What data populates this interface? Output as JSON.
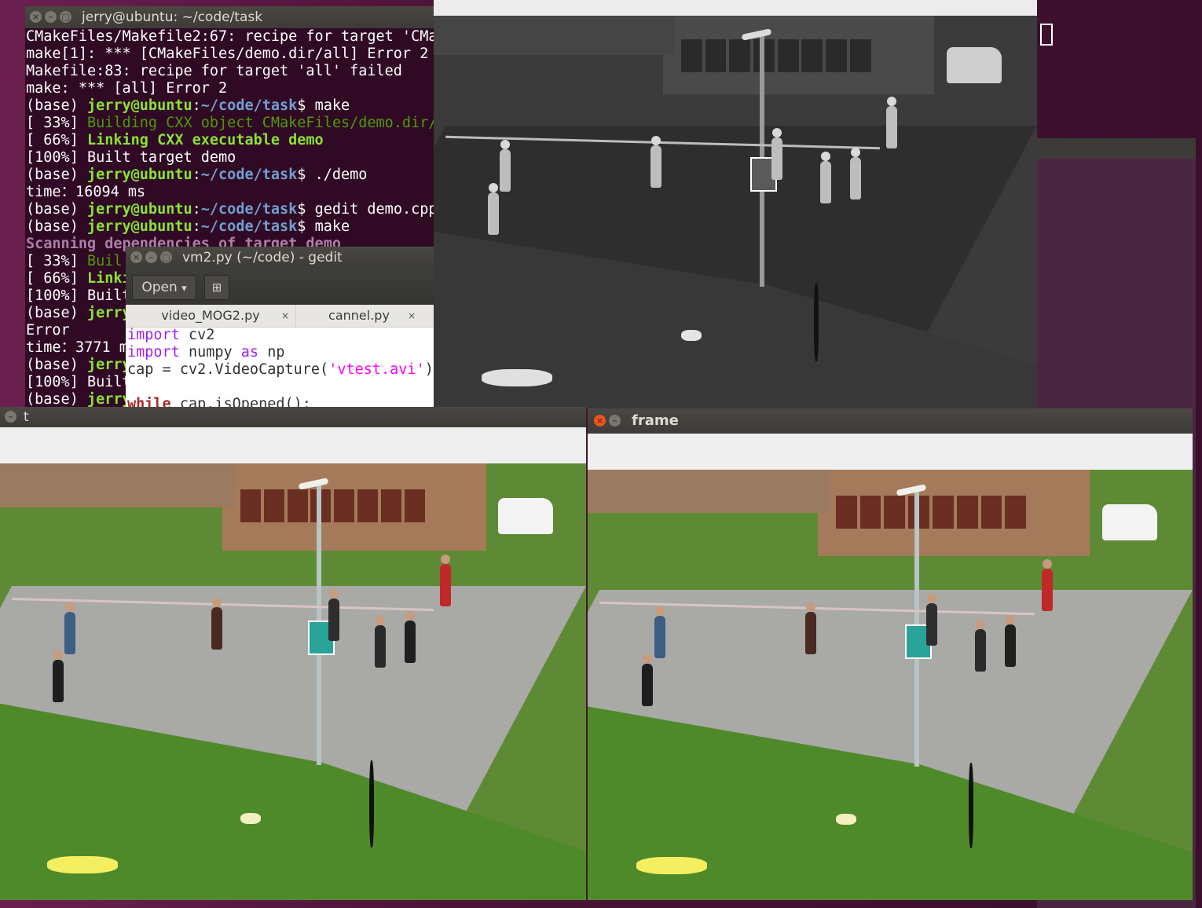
{
  "terminal": {
    "title": "jerry@ubuntu: ~/code/task",
    "lines": [
      [
        {
          "t": "CMakeFiles/Makefile2:67: recipe for target 'CMa",
          "c": ""
        }
      ],
      [
        {
          "t": "make[1]: *** [CMakeFiles/demo.dir/all] Error 2",
          "c": ""
        }
      ],
      [
        {
          "t": "Makefile:83: recipe for target 'all' failed",
          "c": ""
        }
      ],
      [
        {
          "t": "make: *** [all] Error 2",
          "c": ""
        }
      ],
      [
        {
          "t": "(base) ",
          "c": ""
        },
        {
          "t": "jerry@ubuntu",
          "c": "pgreen"
        },
        {
          "t": ":",
          "c": ""
        },
        {
          "t": "~/code/task",
          "c": "pblue"
        },
        {
          "t": "$ make",
          "c": ""
        }
      ],
      [
        {
          "t": "[ 33%] ",
          "c": ""
        },
        {
          "t": "Building CXX object CMakeFiles/demo.dir/",
          "c": "cgreen"
        }
      ],
      [
        {
          "t": "[ 66%] ",
          "c": ""
        },
        {
          "t": "Linking CXX executable demo",
          "c": "cgreenb"
        }
      ],
      [
        {
          "t": "[100%] Built target demo",
          "c": ""
        }
      ],
      [
        {
          "t": "(base) ",
          "c": ""
        },
        {
          "t": "jerry@ubuntu",
          "c": "pgreen"
        },
        {
          "t": ":",
          "c": ""
        },
        {
          "t": "~/code/task",
          "c": "pblue"
        },
        {
          "t": "$ ./demo",
          "c": ""
        }
      ],
      [
        {
          "t": "time：16094 ms",
          "c": ""
        }
      ],
      [
        {
          "t": "(base) ",
          "c": ""
        },
        {
          "t": "jerry@ubuntu",
          "c": "pgreen"
        },
        {
          "t": ":",
          "c": ""
        },
        {
          "t": "~/code/task",
          "c": "pblue"
        },
        {
          "t": "$ gedit demo.cpp",
          "c": ""
        }
      ],
      [
        {
          "t": "(base) ",
          "c": ""
        },
        {
          "t": "jerry@ubuntu",
          "c": "pgreen"
        },
        {
          "t": ":",
          "c": ""
        },
        {
          "t": "~/code/task",
          "c": "pblue"
        },
        {
          "t": "$ make",
          "c": ""
        }
      ],
      [
        {
          "t": "Scanning dependencies of target demo",
          "c": "cmag"
        }
      ],
      [
        {
          "t": "[ 33%] ",
          "c": ""
        },
        {
          "t": "Buil",
          "c": "cgreen"
        }
      ],
      [
        {
          "t": "[ 66%] ",
          "c": ""
        },
        {
          "t": "Linki",
          "c": "cgreenb"
        }
      ],
      [
        {
          "t": "[100%] Built",
          "c": ""
        }
      ],
      [
        {
          "t": "(base) ",
          "c": ""
        },
        {
          "t": "jerry",
          "c": "pgreen"
        }
      ],
      [
        {
          "t": "Error",
          "c": ""
        }
      ],
      [
        {
          "t": "time：3771 m",
          "c": ""
        }
      ],
      [
        {
          "t": "(base) ",
          "c": ""
        },
        {
          "t": "jerry",
          "c": "pgreen"
        }
      ],
      [
        {
          "t": "[100%] Built",
          "c": ""
        }
      ],
      [
        {
          "t": "(base) ",
          "c": ""
        },
        {
          "t": "jerry",
          "c": "pgreen"
        }
      ]
    ]
  },
  "gedit": {
    "title": "vm2.py (~/code) - gedit",
    "open_label": "Open",
    "open_arrow": "▾",
    "new_tab_glyph": "⊞",
    "tabs": [
      {
        "label": "video_MOG2.py",
        "close": "×"
      },
      {
        "label": "cannel.py",
        "close": "×"
      }
    ],
    "code": [
      [
        {
          "t": "import",
          "c": "kw"
        },
        {
          "t": " cv2",
          "c": ""
        }
      ],
      [
        {
          "t": "import",
          "c": "kw"
        },
        {
          "t": " numpy ",
          "c": ""
        },
        {
          "t": "as",
          "c": "kw"
        },
        {
          "t": " np",
          "c": ""
        }
      ],
      [
        {
          "t": "cap = cv2.VideoCapture(",
          "c": ""
        },
        {
          "t": "'vtest.avi'",
          "c": "str"
        },
        {
          "t": ")",
          "c": ""
        }
      ],
      [
        {
          "t": "",
          "c": ""
        }
      ],
      [
        {
          "t": "while",
          "c": "kwb"
        },
        {
          "t": " cap.isOpened():",
          "c": ""
        }
      ]
    ]
  },
  "t_window": {
    "title": "t"
  },
  "frame_window": {
    "title": "frame"
  },
  "colors": {
    "terminal_bg": "#300a24",
    "prompt_green": "#8ae234",
    "prompt_blue": "#729fcf",
    "close_orange": "#e95420"
  }
}
